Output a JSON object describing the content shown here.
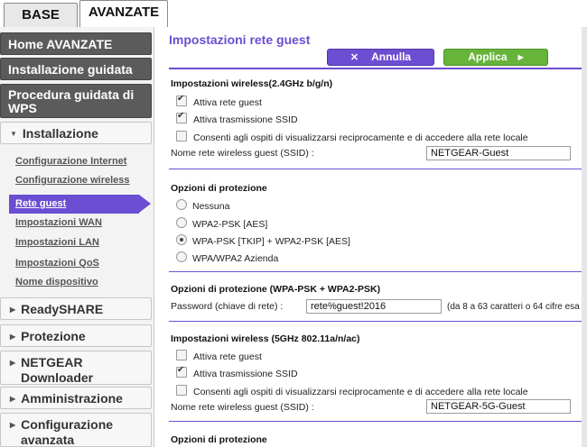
{
  "tabs": {
    "base": "BASE",
    "advanced": "AVANZATE"
  },
  "sidebar": {
    "home": "Home AVANZATE",
    "setup_wizard": "Installazione guidata",
    "wps_wizard_line1": "Procedura guidata di",
    "wps_wizard_line2": "WPS",
    "installation": "Installazione",
    "sub_items": [
      "Configurazione Internet",
      "Configurazione wireless",
      "Rete guest",
      "Impostazioni WAN",
      "Impostazioni LAN",
      "Impostazioni QoS",
      "Nome dispositivo"
    ],
    "readyshare": "ReadySHARE",
    "protection": "Protezione",
    "netgear_downloader_line1": "NETGEAR",
    "netgear_downloader_line2": "Downloader",
    "administration": "Amministrazione",
    "advanced_config_line1": "Configurazione",
    "advanced_config_line2": "avanzata"
  },
  "main": {
    "title": "Impostazioni rete guest",
    "cancel_label": "Annulla",
    "apply_label": "Applica",
    "wireless24": {
      "title": "Impostazioni wireless(2.4GHz b/g/n)",
      "enable_guest": "Attiva rete guest",
      "enable_ssid": "Attiva trasmissione SSID",
      "allow_see": "Consenti agli ospiti di visualizzarsi reciprocamente e di accedere alla rete locale",
      "ssid_label": "Nome rete wireless guest (SSID) :",
      "ssid_value": "NETGEAR-Guest"
    },
    "security24": {
      "title": "Opzioni di protezione",
      "options": [
        "Nessuna",
        "WPA2-PSK [AES]",
        "WPA-PSK [TKIP] + WPA2-PSK [AES]",
        "WPA/WPA2 Azienda"
      ]
    },
    "psk": {
      "title": "Opzioni di protezione (WPA-PSK + WPA2-PSK)",
      "password_label": "Password (chiave di rete) :",
      "password_value": "rete%guest!2016",
      "hint": "(da 8 a 63 caratteri o 64 cifre esa"
    },
    "wireless5": {
      "title": "Impostazioni wireless (5GHz 802.11a/n/ac)",
      "enable_guest": "Attiva rete guest",
      "enable_ssid": "Attiva trasmissione SSID",
      "allow_see": "Consenti agli ospiti di visualizzarsi reciprocamente e di accedere alla rete locale",
      "ssid_label": "Nome rete wireless guest (SSID) :",
      "ssid_value": "NETGEAR-5G-Guest"
    },
    "security5": {
      "title": "Opzioni di protezione"
    }
  },
  "colors": {
    "accent": "#6b4ed1",
    "apply": "#66b43a",
    "sidebar_dark": "#5b5b5b"
  },
  "icons": {
    "cancel": "close-icon",
    "apply": "chevron-right-icon",
    "collapsed": "triangle-right-icon",
    "expanded": "triangle-down-icon"
  }
}
